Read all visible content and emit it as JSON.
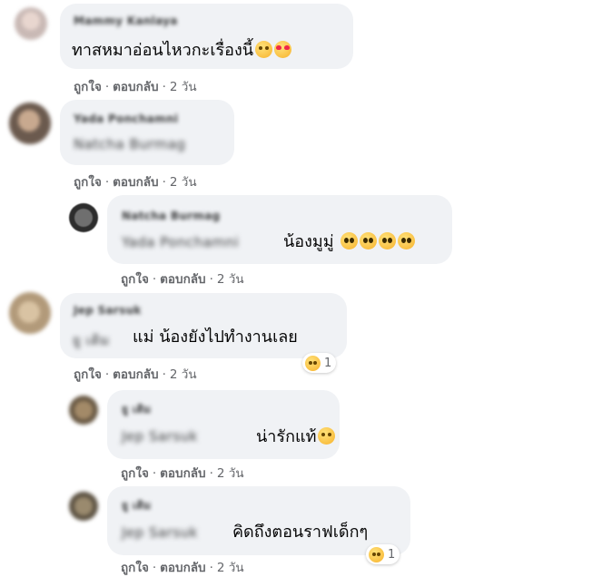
{
  "action_like": "ถูกใจ",
  "action_reply": "ตอบกลับ",
  "comments": [
    {
      "author": "Mammy Kanlaya",
      "text": "ทาสหมาอ่อนไหวกะเรื่องนี้",
      "emoji": [
        "smile-emoji",
        "heart-eyes-emoji"
      ],
      "time": "2 วัน"
    },
    {
      "author": "Yada Ponchamni",
      "mention": "Natcha Burmag",
      "text": "",
      "time": "2 วัน",
      "replies": [
        {
          "author": "Natcha Burmag",
          "mention": "Yada Ponchamni",
          "text": "น้องมูมู่",
          "emoji": [
            "pleading-emoji",
            "pleading-emoji",
            "pleading-emoji",
            "pleading-emoji"
          ],
          "time": "2 วัน"
        }
      ]
    },
    {
      "author": "Jep Sarsuk",
      "mention": "ยู เติม",
      "text": "แม่ น้องยังไปทำงานเลย",
      "reaction": {
        "icon": "haha-emoji",
        "count": "1"
      },
      "time": "2 วัน",
      "replies": [
        {
          "author": "ยู เติม",
          "mention": "Jep Sarsuk",
          "text": "น่ารักแท้",
          "emoji": [
            "smile-emoji"
          ],
          "time": "2 วัน"
        },
        {
          "author": "ยู เติม",
          "mention": "Jep Sarsuk",
          "text": "คิดถึงตอนราฟเด็กๆ",
          "reaction": {
            "icon": "haha-emoji",
            "count": "1"
          },
          "time": "2 วัน"
        }
      ]
    }
  ]
}
